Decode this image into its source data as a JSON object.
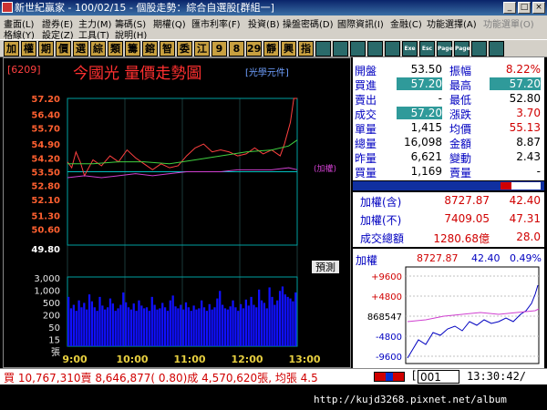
{
  "window": {
    "title": "新世紀贏家 - 100/02/15 - 個股走勢：綜合自選股[群組一]",
    "min": "_",
    "max": "□",
    "close": "×"
  },
  "menu": {
    "row1": [
      "畫面(L)",
      "證券(E)",
      "主力(M)",
      "籌碼(S)",
      "期權(Q)",
      "匯市利率(F)",
      "投資(B)",
      "操盤密碼(D)",
      "國際資訊(I)",
      "金融(C)",
      "功能選擇(A)",
      "功能選單(O)"
    ],
    "row2": [
      "格線(Y)",
      "設定(Z)",
      "工具(T)",
      "說明(H)"
    ]
  },
  "toolbar": {
    "buttons": [
      "加",
      "權",
      "期",
      "價",
      "選",
      "綜",
      "類",
      "籌",
      "鎔",
      "智",
      "委",
      "江",
      "9",
      "8",
      "29",
      "靜",
      "興",
      "指",
      "",
      "",
      "",
      "",
      "",
      "Exe",
      "Esc",
      "Page",
      "Page",
      "",
      ""
    ]
  },
  "stock": {
    "code": "[6209]",
    "name": "今國光  量價走勢圖",
    "tag": "[光學元件]",
    "index_tag": "(加權)",
    "forecast": "預測"
  },
  "chart_data": {
    "type": "line",
    "title": "今國光 量價走勢圖",
    "price_ticks": [
      "57.20",
      "56.40",
      "55.70",
      "54.90",
      "54.20",
      "53.50",
      "52.80",
      "52.10",
      "51.30",
      "50.60",
      "49.80"
    ],
    "volume_ticks": [
      "3,000",
      "1,000",
      "500",
      "200",
      "50",
      "15",
      "張"
    ],
    "x_ticks": [
      "9:00",
      "10:00",
      "11:00",
      "12:00",
      "13:00"
    ],
    "ylim": [
      49.8,
      57.2
    ],
    "reference": 53.5,
    "series": [
      {
        "name": "price",
        "x": [
          0,
          5,
          10,
          15,
          20,
          30,
          40,
          50,
          60,
          70,
          80,
          90,
          100,
          110,
          120,
          130,
          140,
          150,
          160,
          170,
          180,
          190,
          200,
          210,
          220,
          230,
          240,
          250,
          255,
          262,
          266,
          270
        ],
        "values": [
          54.0,
          53.7,
          54.5,
          54.0,
          53.3,
          54.1,
          53.8,
          54.3,
          54.0,
          54.6,
          54.2,
          53.9,
          53.6,
          53.9,
          53.7,
          53.8,
          54.3,
          54.7,
          54.9,
          54.5,
          54.6,
          54.5,
          54.3,
          54.4,
          54.7,
          54.4,
          54.6,
          54.3,
          54.9,
          56.0,
          57.2,
          57.2
        ]
      },
      {
        "name": "avg",
        "x": [
          0,
          30,
          60,
          90,
          120,
          150,
          180,
          210,
          240,
          260,
          270
        ],
        "values": [
          53.9,
          53.9,
          54.0,
          54.0,
          53.9,
          54.1,
          54.3,
          54.5,
          54.6,
          54.8,
          55.1
        ]
      },
      {
        "name": "index",
        "x": [
          0,
          20,
          40,
          60,
          80,
          100,
          120,
          140,
          160,
          180,
          200,
          220,
          240,
          260,
          270
        ],
        "values": [
          53.2,
          53.3,
          53.2,
          53.3,
          53.4,
          53.3,
          53.4,
          53.5,
          53.5,
          53.5,
          53.6,
          53.6,
          53.6,
          53.7,
          53.6
        ]
      }
    ],
    "volume": [
      300,
      80,
      120,
      60,
      200,
      90,
      150,
      70,
      400,
      180,
      90,
      60,
      300,
      110,
      70,
      90,
      250,
      140,
      60,
      80,
      120,
      500,
      160,
      90,
      70,
      140,
      60,
      200,
      110,
      80,
      90,
      60,
      300,
      120,
      70,
      80,
      150,
      90,
      60,
      200,
      350,
      100,
      80,
      120,
      70,
      160,
      90,
      60,
      110,
      70,
      80,
      200,
      90,
      60,
      130,
      70,
      90,
      250,
      600,
      120,
      80,
      70,
      100,
      200,
      90,
      60,
      130,
      80,
      220,
      110,
      300,
      120,
      90,
      700,
      200,
      150,
      80,
      900,
      300,
      120,
      200,
      600,
      1000,
      400,
      300,
      250,
      180,
      500
    ]
  },
  "quote": [
    {
      "l": "開盤",
      "v": "53.50",
      "l2": "振幅",
      "v2": "8.22%",
      "c1": "#000000",
      "c2": "#d00000"
    },
    {
      "l": "買進",
      "v": "57.20",
      "l2": "最高",
      "v2": "57.20",
      "c1": "#ffffff",
      "c2": "#ffffff",
      "hl1": true,
      "hl2": true
    },
    {
      "l": "賣出",
      "v": "-",
      "l2": "最低",
      "v2": "52.80",
      "c1": "#000000",
      "c2": "#000000"
    },
    {
      "l": "成交",
      "v": "57.20",
      "l2": "漲跌",
      "v2": "3.70",
      "c1": "#ffffff",
      "c2": "#d00000",
      "hl1": true
    },
    {
      "l": "單量",
      "v": "1,415",
      "l2": "均價",
      "v2": "55.13",
      "c1": "#000000",
      "c2": "#d00000"
    },
    {
      "l": "總量",
      "v": "16,098",
      "l2": "金額",
      "v2": "8.87",
      "c1": "#000000",
      "c2": "#000000"
    },
    {
      "l": "昨量",
      "v": "6,621",
      "l2": "變動",
      "v2": "2.43",
      "c1": "#000000",
      "c2": "#000000"
    },
    {
      "l": "買量",
      "v": "1,169",
      "l2": "賣量",
      "v2": "-",
      "c1": "#000000",
      "c2": "#000000"
    }
  ],
  "index_panel": [
    {
      "l": "加權(含)",
      "v": "8727.87",
      "v2": "42.40"
    },
    {
      "l": "加權(不)",
      "v": "7409.05",
      "v2": "47.31"
    },
    {
      "l": "成交總額",
      "v": "1280.68億",
      "v2": "28.0"
    }
  ],
  "mini": {
    "label": "加權",
    "value": "8727.87",
    "change": "42.40",
    "pct": "0.49%",
    "ticks": [
      "+9600",
      "+4800",
      "868547",
      "-4800",
      "-9600"
    ]
  },
  "statusline": "買 10,767,310賣 8,646,877( 0.80)成 4,570,620張, 均張 4.5",
  "statusfield": "001",
  "clock": "13:30:42/",
  "watermark": "http://kujd3268.pixnet.net/album",
  "colors": {
    "price": "#ff4040",
    "avg": "#40d040",
    "index": "#d040d0",
    "ref_line": "#00c0c0",
    "volume": "#1010ff"
  }
}
